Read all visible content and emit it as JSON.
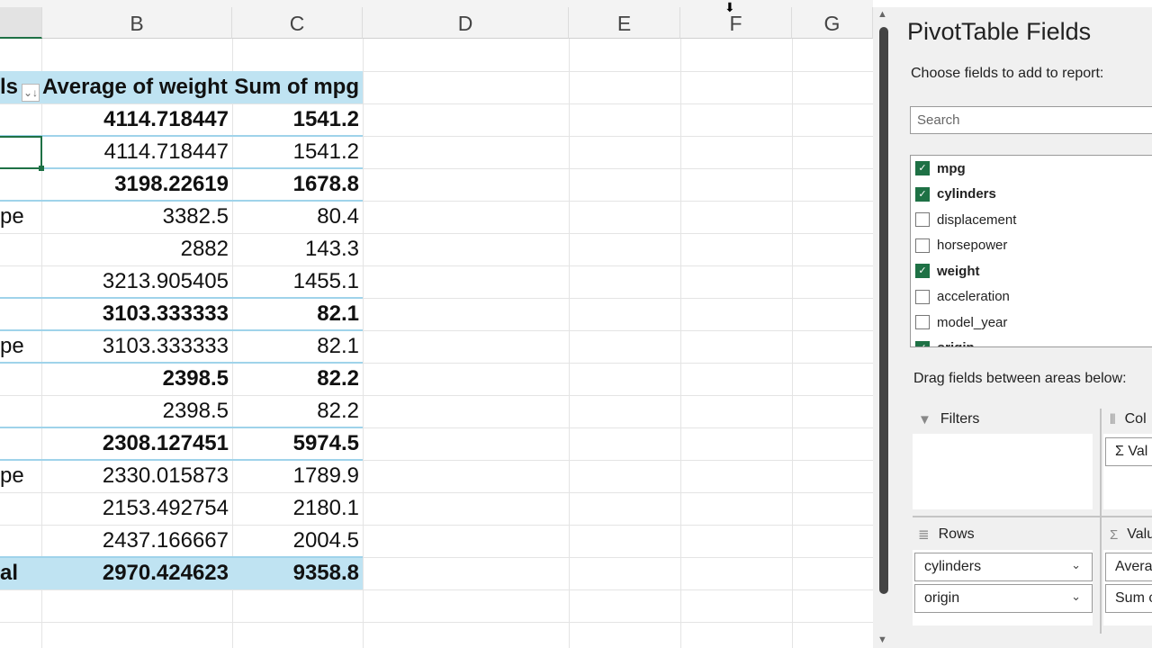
{
  "columns": [
    "B",
    "C",
    "D",
    "E",
    "F",
    "G"
  ],
  "pivot": {
    "header": {
      "row_labels": "ls",
      "col1": "Average of weight",
      "col2": "Sum of mpg"
    },
    "rows": [
      {
        "label": "",
        "avg_weight": "4114.718447",
        "sum_mpg": "1541.2",
        "bold": true
      },
      {
        "label": "",
        "avg_weight": "4114.718447",
        "sum_mpg": "1541.2",
        "bold": false
      },
      {
        "label": "",
        "avg_weight": "3198.22619",
        "sum_mpg": "1678.8",
        "bold": true
      },
      {
        "label": "pe",
        "avg_weight": "3382.5",
        "sum_mpg": "80.4",
        "bold": false
      },
      {
        "label": "",
        "avg_weight": "2882",
        "sum_mpg": "143.3",
        "bold": false
      },
      {
        "label": "",
        "avg_weight": "3213.905405",
        "sum_mpg": "1455.1",
        "bold": false
      },
      {
        "label": "",
        "avg_weight": "3103.333333",
        "sum_mpg": "82.1",
        "bold": true
      },
      {
        "label": "pe",
        "avg_weight": "3103.333333",
        "sum_mpg": "82.1",
        "bold": false
      },
      {
        "label": "",
        "avg_weight": "2398.5",
        "sum_mpg": "82.2",
        "bold": true
      },
      {
        "label": "",
        "avg_weight": "2398.5",
        "sum_mpg": "82.2",
        "bold": false
      },
      {
        "label": "",
        "avg_weight": "2308.127451",
        "sum_mpg": "5974.5",
        "bold": true
      },
      {
        "label": "pe",
        "avg_weight": "2330.015873",
        "sum_mpg": "1789.9",
        "bold": false
      },
      {
        "label": "",
        "avg_weight": "2153.492754",
        "sum_mpg": "2180.1",
        "bold": false
      },
      {
        "label": "",
        "avg_weight": "2437.166667",
        "sum_mpg": "2004.5",
        "bold": false
      }
    ],
    "total": {
      "label": "al",
      "avg_weight": "2970.424623",
      "sum_mpg": "9358.8"
    }
  },
  "panel": {
    "title": "PivotTable Fields",
    "subtitle": "Choose fields to add to report:",
    "search_placeholder": "Search",
    "fields": [
      {
        "name": "mpg",
        "checked": true
      },
      {
        "name": "cylinders",
        "checked": true
      },
      {
        "name": "displacement",
        "checked": false
      },
      {
        "name": "horsepower",
        "checked": false
      },
      {
        "name": "weight",
        "checked": true
      },
      {
        "name": "acceleration",
        "checked": false
      },
      {
        "name": "model_year",
        "checked": false
      },
      {
        "name": "origin",
        "checked": true
      }
    ],
    "drag_label": "Drag fields between areas below:",
    "areas": {
      "filters": "Filters",
      "columns": "Col",
      "columns_items": [
        "Σ Val"
      ],
      "rows": "Rows",
      "rows_items": [
        "cylinders",
        "origin"
      ],
      "values": "Valu",
      "values_items": [
        "Averag",
        "Sum c"
      ]
    }
  },
  "colors": {
    "accent": "#1e7145",
    "pivot_header": "#bfe3f2",
    "pivot_line": "#9fd3ea"
  }
}
